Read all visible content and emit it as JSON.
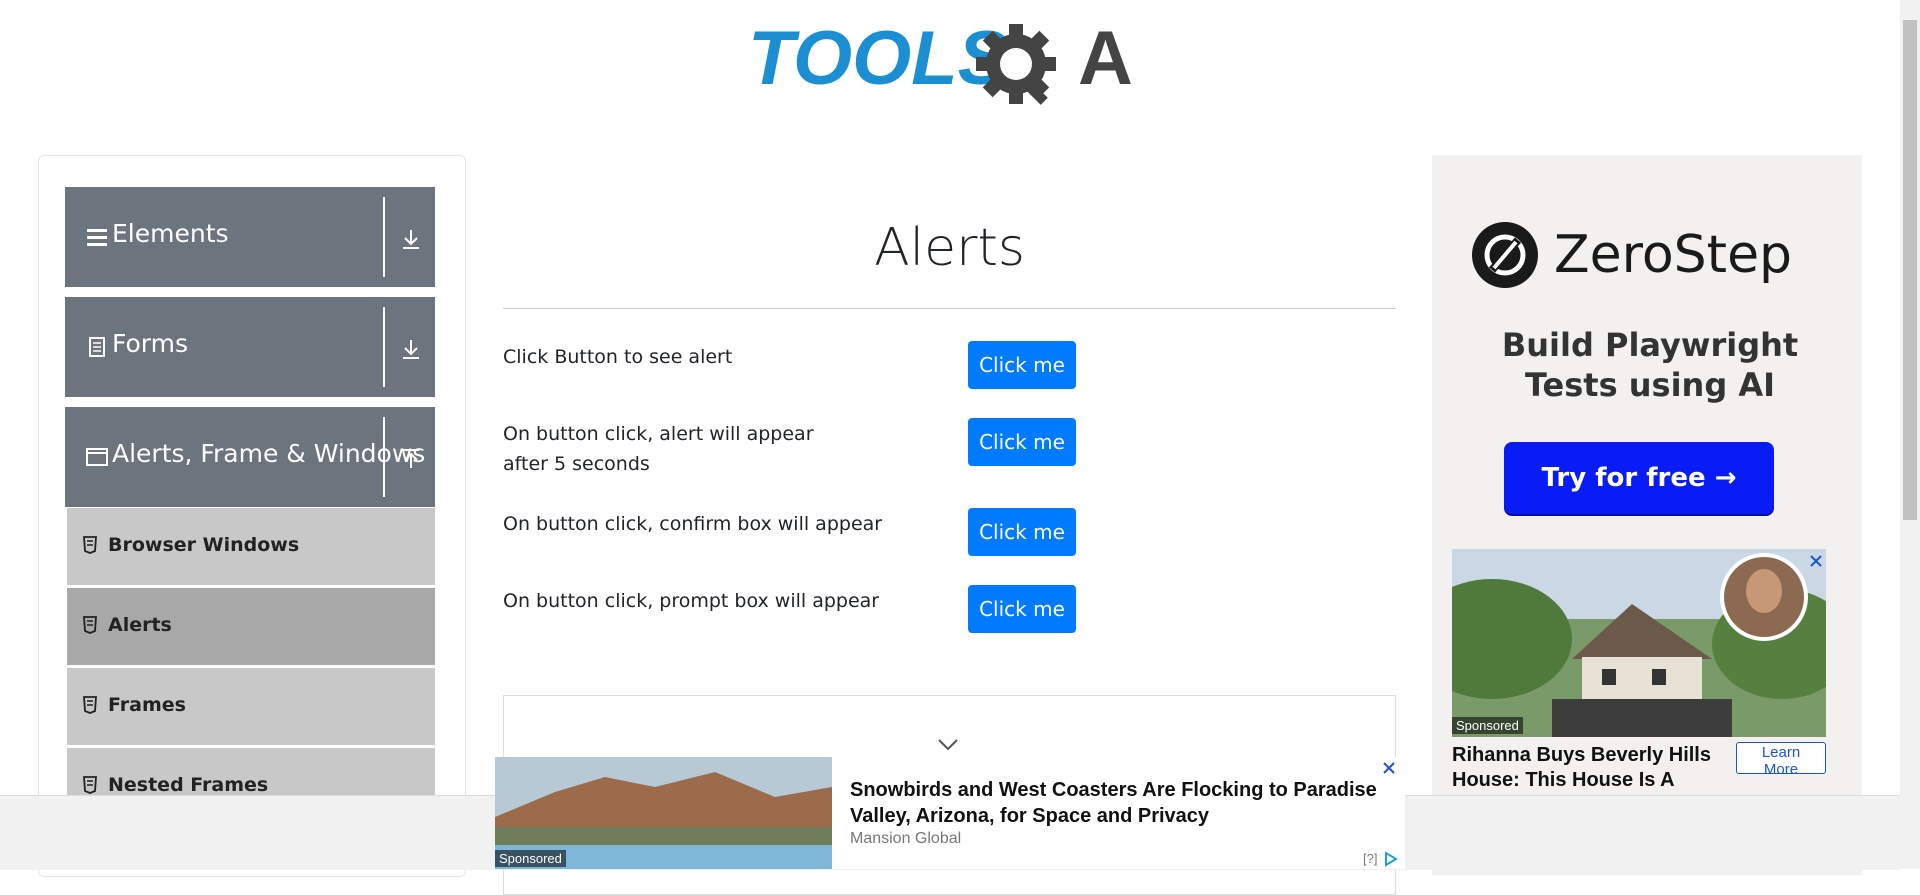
{
  "logo": {
    "text_left": "TOOLS",
    "text_right": "A",
    "brand_blue": "#1b8fd1",
    "brand_dark": "#444444"
  },
  "sidebar": {
    "groups": [
      {
        "label": "Elements",
        "icon": "hamburger-icon",
        "arrow": "download-icon"
      },
      {
        "label": "Forms",
        "icon": "document-icon",
        "arrow": "download-icon"
      },
      {
        "label": "Alerts, Frame & Windows",
        "icon": "window-icon",
        "arrow": "upload-icon"
      }
    ],
    "items": [
      {
        "label": "Browser Windows",
        "active": false
      },
      {
        "label": "Alerts",
        "active": true
      },
      {
        "label": "Frames",
        "active": false
      },
      {
        "label": "Nested Frames",
        "active": false
      }
    ]
  },
  "main": {
    "title": "Alerts",
    "rows": [
      {
        "label": "Click Button to see alert",
        "button": "Click me"
      },
      {
        "label": "On button click, alert will appear after 5 seconds",
        "button": "Click me"
      },
      {
        "label": "On button click, confirm box will appear",
        "button": "Click me"
      },
      {
        "label": "On button click, prompt box will appear",
        "button": "Click me"
      }
    ]
  },
  "right_ad": {
    "brand": "ZeroStep",
    "tagline": "Build Playwright Tests using AI",
    "cta": "Try for free →",
    "cta_color": "#0a1cf5",
    "sponsored": "Sponsored",
    "headline": "Rihanna Buys Beverly Hills House: This House Is A",
    "learn_more": "Learn More"
  },
  "bottom_ad": {
    "headline": "Snowbirds and West Coasters Are Flocking to Paradise Valley, Arizona, for Space and Privacy",
    "source": "Mansion Global",
    "sponsored": "Sponsored",
    "adchoice": "[?]"
  },
  "colors": {
    "sidebar_group": "#6c757d",
    "sub_item": "#c8c8c8",
    "sub_item_active": "#a8a8a8",
    "button": "#007bff"
  }
}
